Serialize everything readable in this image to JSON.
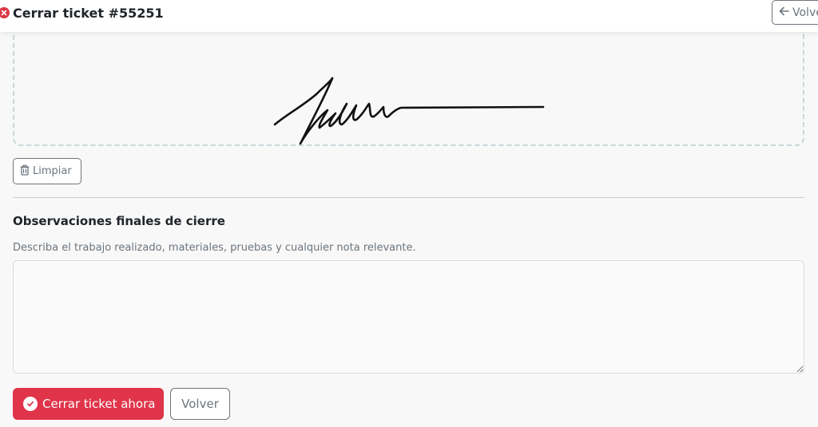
{
  "header": {
    "title": "Cerrar ticket #55251",
    "back_label": "Volve"
  },
  "signature": {
    "clear_label": "Limpiar"
  },
  "observations": {
    "heading": "Observaciones finales de cierre",
    "help_text": "Describa el trabajo realizado, materiales, pruebas y cualquier nota relevante.",
    "value": "",
    "placeholder": ""
  },
  "actions": {
    "close_ticket_label": "Cerrar ticket ahora",
    "back_label": "Volver"
  },
  "colors": {
    "danger": "#e0344a",
    "secondary": "#6c757d",
    "signature_border": "#c9d6dc"
  },
  "icons": {
    "title": "x-circle-icon",
    "back": "arrow-left-icon",
    "clear": "trash-icon",
    "close_ticket": "check-circle-icon"
  }
}
